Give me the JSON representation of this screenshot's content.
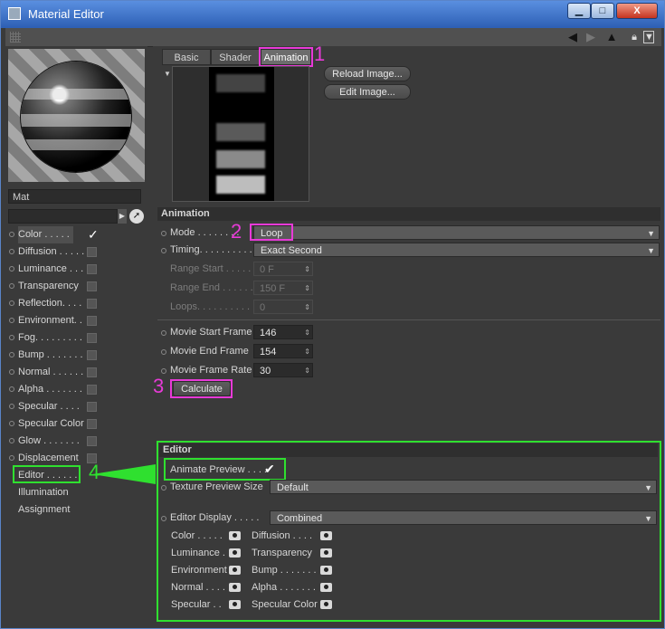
{
  "window": {
    "title": "Material Editor",
    "minimize": "▁",
    "maximize": "□",
    "close": "X"
  },
  "toolbar": {
    "icons": [
      "arrow-left-icon",
      "arrow-right-icon",
      "arrow-up-icon",
      "lock-icon",
      "pin-icon"
    ]
  },
  "material": {
    "name": "Mat"
  },
  "channels": [
    {
      "label": "Color . . . . .",
      "checked": true,
      "selected": true
    },
    {
      "label": "Diffusion . . . . .",
      "checked": false
    },
    {
      "label": "Luminance . . . .",
      "checked": false
    },
    {
      "label": "Transparency",
      "checked": false
    },
    {
      "label": "Reflection. . . .",
      "checked": false
    },
    {
      "label": "Environment. .",
      "checked": false
    },
    {
      "label": "Fog. . . . . . . . .",
      "checked": false
    },
    {
      "label": "Bump . . . . . . .",
      "checked": false
    },
    {
      "label": "Normal . . . . . .",
      "checked": false
    },
    {
      "label": "Alpha . . . . . . .",
      "checked": false
    },
    {
      "label": "Specular . . . .",
      "checked": false
    },
    {
      "label": "Specular Color",
      "checked": false
    },
    {
      "label": "Glow . . . . . . .",
      "checked": false
    },
    {
      "label": "Displacement",
      "checked": false
    }
  ],
  "extra_items": [
    "Editor . . . . . .",
    "Illumination",
    "Assignment"
  ],
  "tabs": [
    "Basic",
    "Shader",
    "Animation"
  ],
  "buttons": {
    "reload": "Reload Image...",
    "edit": "Edit Image...",
    "calculate": "Calculate"
  },
  "animation": {
    "section": "Animation",
    "mode_label": "Mode . . . . . . . .",
    "mode_value": "Loop",
    "timing_label": "Timing. . . . . . . . . .",
    "timing_value": "Exact Second",
    "range_start_label": "Range Start . . . . .",
    "range_start_value": "0 F",
    "range_end_label": "Range End . . . . . .",
    "range_end_value": "150 F",
    "loops_label": "Loops. . . . . . . . . .",
    "loops_value": "0",
    "movie_start_label": "Movie Start Frame",
    "movie_start_value": "146",
    "movie_end_label": "Movie End Frame",
    "movie_end_value": "154",
    "movie_rate_label": "Movie Frame Rate",
    "movie_rate_value": "30"
  },
  "editor": {
    "section": "Editor",
    "animate_preview_label": "Animate Preview . . . .",
    "texture_preview_label": "Texture Preview Size",
    "texture_preview_value": "Default",
    "editor_display_label": "Editor Display . . . . .",
    "editor_display_value": "Combined",
    "display_items": [
      [
        "Color . . . . .",
        "Diffusion . . . ."
      ],
      [
        "Luminance . . .",
        "Transparency"
      ],
      [
        "Environment",
        "Bump . . . . . . ."
      ],
      [
        "Normal . . . .",
        "Alpha . . . . . . ."
      ],
      [
        "Specular . .",
        "Specular Color"
      ]
    ]
  },
  "annotations": {
    "a1": "1",
    "a2": "2",
    "a3": "3",
    "a4": "4"
  },
  "colors": {
    "highlight_magenta": "#e83ad8",
    "highlight_green": "#2fe02f"
  }
}
